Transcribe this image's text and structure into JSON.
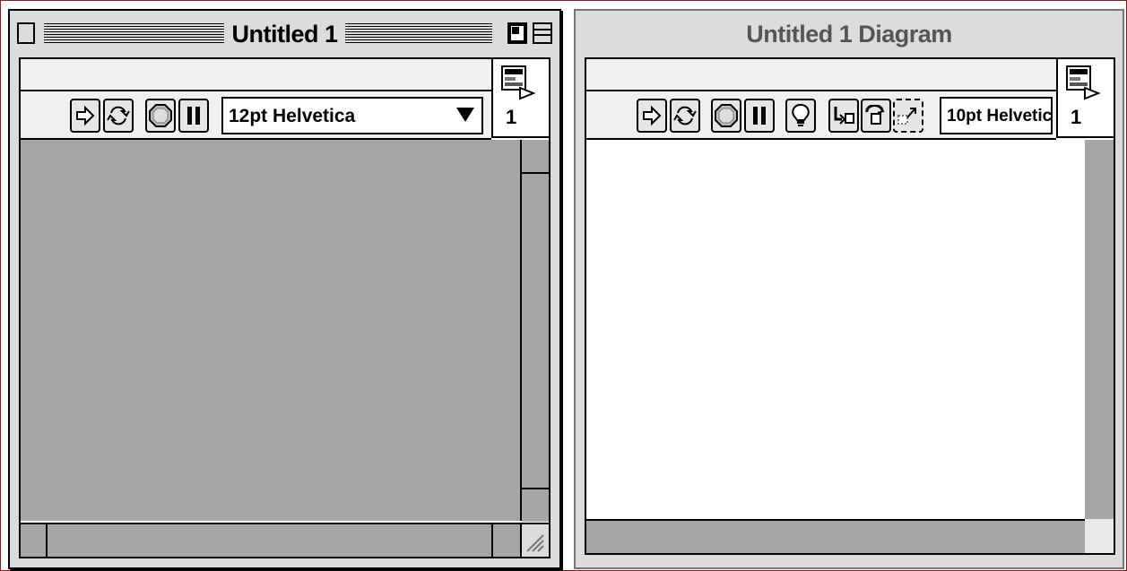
{
  "front_panel": {
    "title": "Untitled 1",
    "font_select": {
      "value": "12pt Helvetica"
    },
    "connector_pane": {
      "pane_number": "1"
    },
    "icons": {
      "close_box": "close-box-icon",
      "tile_box": "tile-window-icon",
      "zoom_box": "zoom-box-icon",
      "run": "run-arrow-icon",
      "run_continuous": "run-continuously-icon",
      "abort": "abort-execution-icon",
      "pause": "pause-icon",
      "grow": "resize-grip-icon"
    },
    "colors": {
      "panel": "#a6a6a6"
    }
  },
  "block_diagram": {
    "title": "Untitled 1 Diagram",
    "font_select": {
      "value": "10pt Helvetic"
    },
    "connector_pane": {
      "pane_number": "1"
    },
    "icons": {
      "run": "run-arrow-icon",
      "run_continuous": "run-continuously-icon",
      "abort": "abort-execution-icon",
      "pause": "pause-icon",
      "highlight": "lightbulb-icon",
      "step_into": "step-into-icon",
      "step_over": "step-over-icon",
      "step_out": "step-out-icon"
    },
    "colors": {
      "diagram": "#ffffff"
    }
  }
}
